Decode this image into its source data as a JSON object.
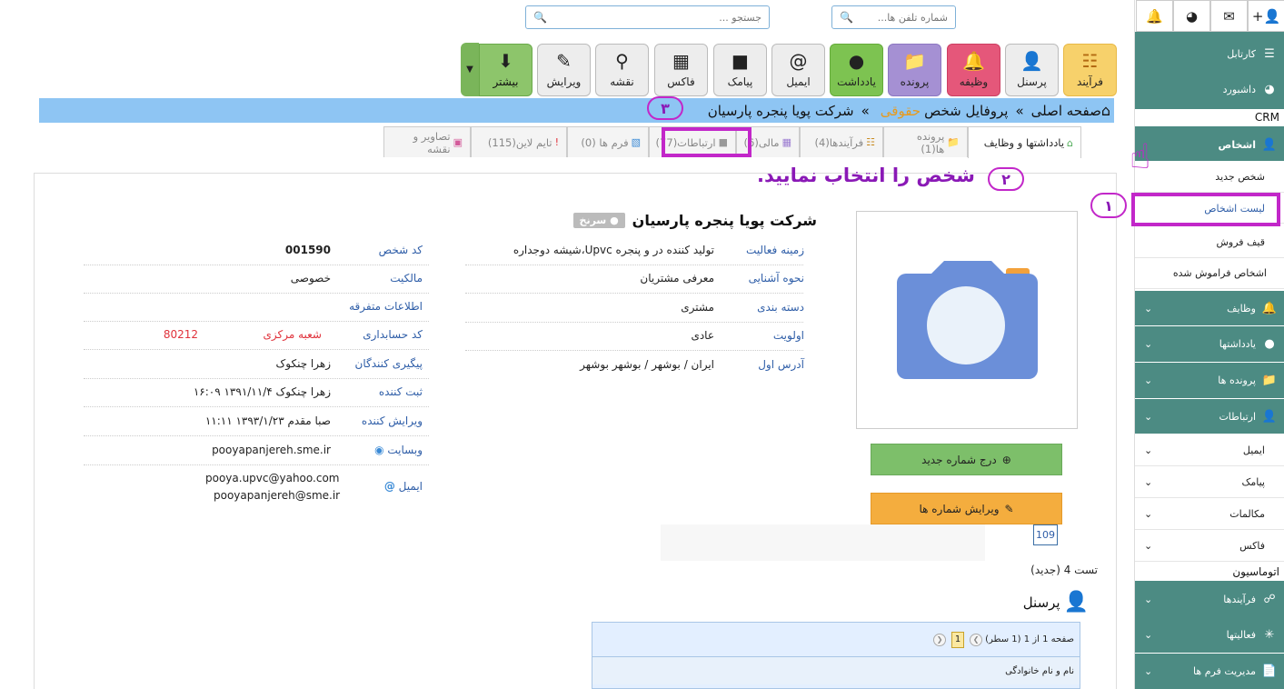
{
  "header": {
    "search_placeholder": "جستجو ...",
    "phone_placeholder": "شماره تلفن ها..."
  },
  "toolbar": {
    "buttons": [
      {
        "label": "فرآیند",
        "icon": "process-icon"
      },
      {
        "label": "پرسنل",
        "icon": "add-user-icon"
      },
      {
        "label": "وظیفه",
        "icon": "bell-icon"
      },
      {
        "label": "پرونده",
        "icon": "folder-icon"
      },
      {
        "label": "یادداشت",
        "icon": "chat-icon"
      },
      {
        "label": "ایمیل",
        "icon": "at-icon"
      },
      {
        "label": "پیامک",
        "icon": "sms-icon"
      },
      {
        "label": "فاکس",
        "icon": "fax-icon"
      },
      {
        "label": "نقشه",
        "icon": "map-pin-icon"
      },
      {
        "label": "ویرایش",
        "icon": "edit-icon"
      },
      {
        "label": "بیشتر",
        "icon": "download-icon"
      }
    ]
  },
  "breadcrumb": {
    "home": "صفحه اصلی",
    "sep": "»",
    "profile": "پروفایل شخص",
    "type": "حقوقی",
    "company": "شرکت پویا پنجره پارسیان"
  },
  "tabs": [
    {
      "label": "یادداشتها و وظایف"
    },
    {
      "label": "پرونده ها(1)"
    },
    {
      "label": "فرآیندها(4)"
    },
    {
      "label": "مالی(6)"
    },
    {
      "label": "ارتباطات(77)"
    },
    {
      "label": "فرم ها (0)"
    },
    {
      "label": "تایم لاین(115)"
    },
    {
      "label": "تصاویر و نقشه"
    }
  ],
  "annotations": {
    "instruction": "شخص را انتخاب نمایید.",
    "step1": "۱",
    "step2": "۲",
    "step3": "۳"
  },
  "sidebar": {
    "kartabl": "کارتابل",
    "dashboard": "داشبورد",
    "crm": "CRM",
    "persons": "اشخاص",
    "new_person": "شخص جدید",
    "person_list": "لیست اشخاص",
    "sales_funnel": "قیف فروش",
    "forgotten": "اشخاص فراموش شده",
    "tasks": "وظایف",
    "notes": "یادداشتها",
    "files": "پرونده ها",
    "communications": "ارتباطات",
    "email": "ایمیل",
    "sms": "پیامک",
    "calls": "مکالمات",
    "fax": "فاکس",
    "automation": "اتوماسیون",
    "processes": "فرآیندها",
    "activities": "فعالیتها",
    "forms_mgmt": "مدیریت فرم ها"
  },
  "profile": {
    "title": "شرکت پویا پنجره پارسیان",
    "badge": "● سرنخ",
    "fields_mid": [
      {
        "label": "زمینه فعالیت",
        "value": "تولید کننده در و پنجره Upvc،شیشه دوجداره"
      },
      {
        "label": "نحوه آشنایی",
        "value": "معرفی مشتریان"
      },
      {
        "label": "دسته بندی",
        "value": "مشتری"
      },
      {
        "label": "اولویت",
        "value": "عادی"
      },
      {
        "label": "آدرس اول",
        "value": "ایران / بوشهر / بوشهر  بوشهر"
      }
    ],
    "person_code_label": "کد شخص",
    "person_code": "001590",
    "ownership_label": "مالکیت",
    "ownership": "خصوصی",
    "misc_label": "اطلاعات متفرقه",
    "acct_label": "کد حسابداری",
    "acct_branch": "شعبه مرکزی",
    "acct_code": "80212",
    "followers_label": "پیگیری کنندگان",
    "followers": "زهرا چنکوک",
    "registrar_label": "ثبت کننده",
    "registrar": "زهرا چنکوک ۱۳۹۱/۱۱/۴  ۱۶:۰۹",
    "editor_label": "ویرایش کننده",
    "editor": "صبا مقدم ۱۳۹۳/۱/۲۳  ۱۱:۱۱",
    "website_label": "وبسایت",
    "website": "pooyapanjereh.sme.ir",
    "email_label": "ایمیل",
    "email1": "pooya.upvc@yahoo.com",
    "email2": "pooyapanjereh@sme.ir"
  },
  "actions": {
    "add_number": "درج شماره جدید",
    "edit_numbers": "ویرایش شماره ها"
  },
  "phone_number": "109",
  "test_label": "تست 4 (جدید)",
  "personnel_title": "پرسنل",
  "grid": {
    "paging": "صفحه 1 از 1 (1 سطر)",
    "current_page": "1",
    "column": "نام و نام خانوادگی"
  }
}
